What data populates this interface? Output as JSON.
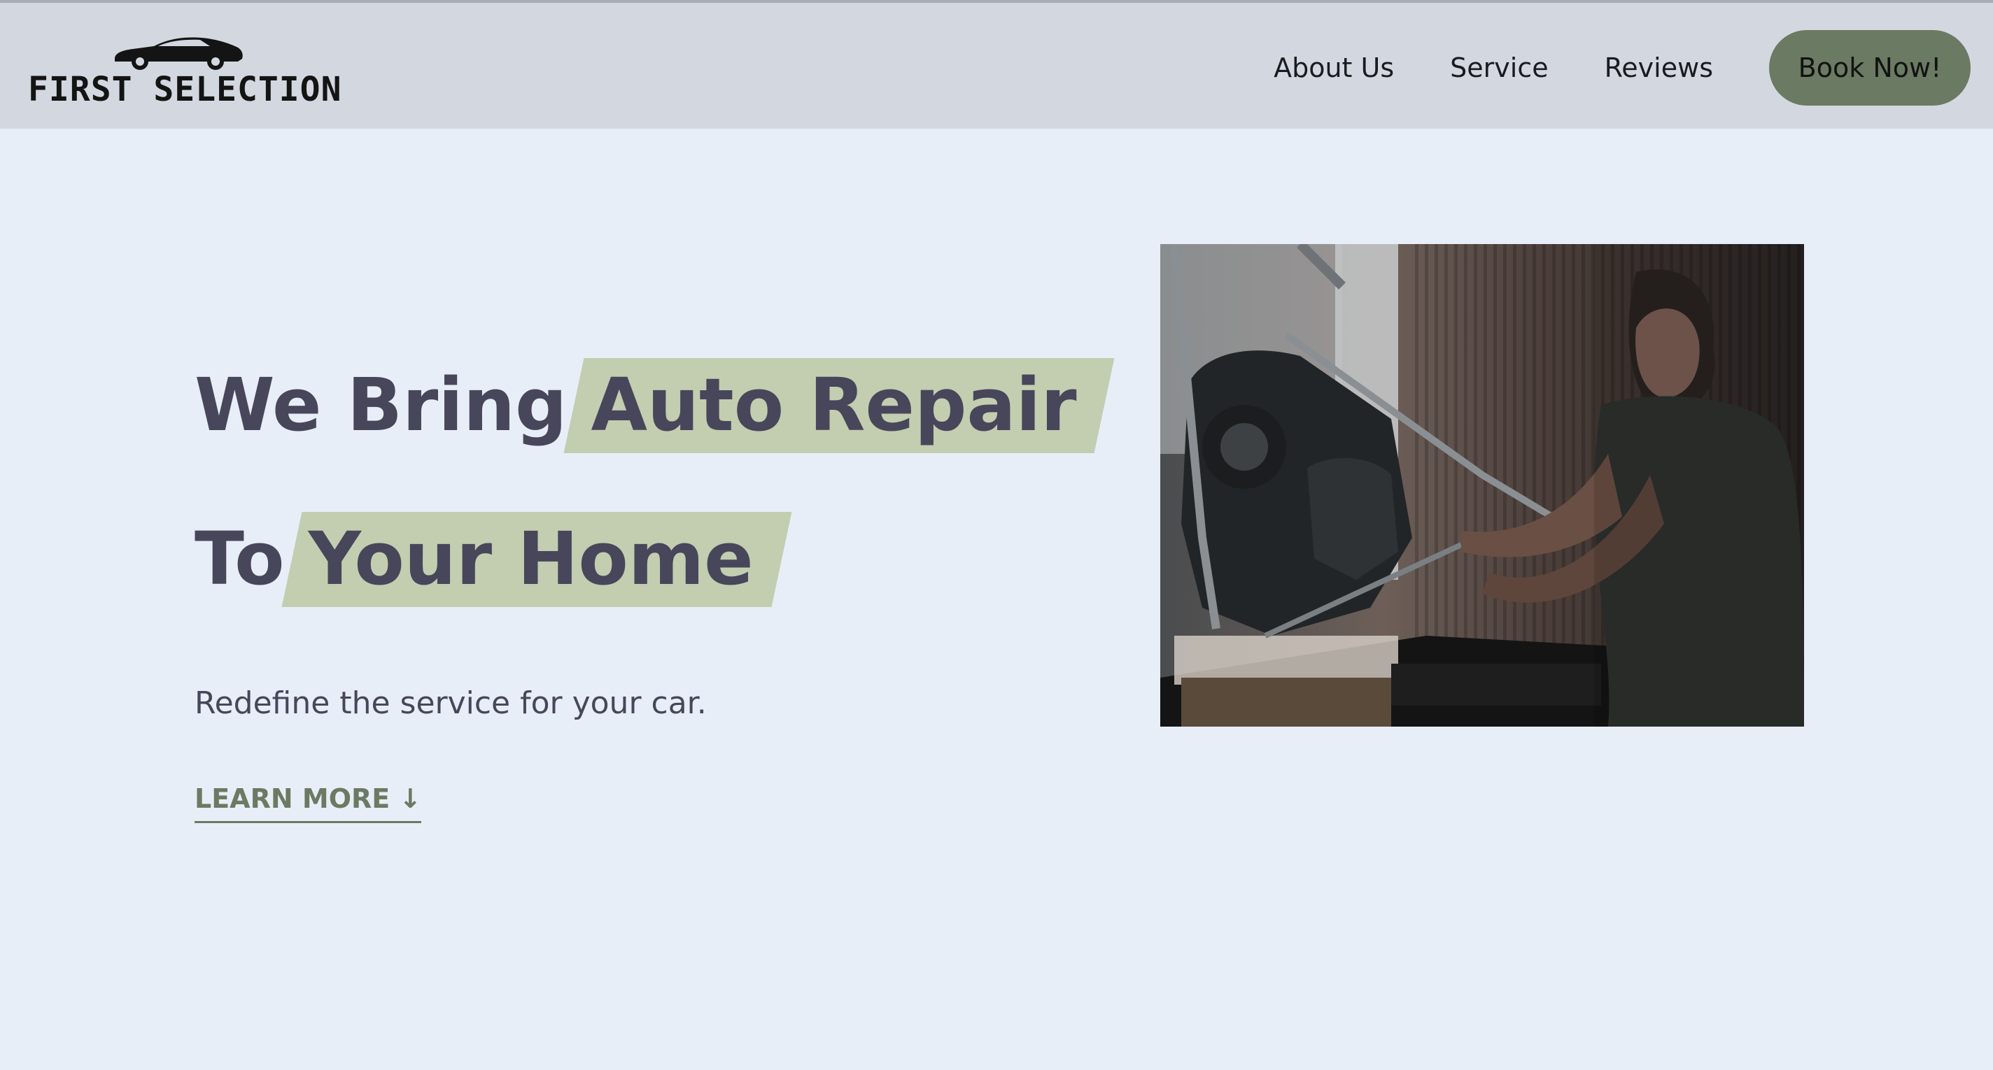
{
  "brand": {
    "name": "FIRST SELECTION",
    "logo_icon": "sports-car-icon"
  },
  "nav": {
    "items": [
      {
        "label": "About Us"
      },
      {
        "label": "Service"
      },
      {
        "label": "Reviews"
      }
    ],
    "cta_label": "Book Now!"
  },
  "hero": {
    "line1_plain": "We Bring",
    "line1_highlight": "Auto Repair",
    "line2_plain": "To",
    "line2_highlight": "Your Home",
    "subtitle": "Redefine the service for your car.",
    "learn_more_label": "LEARN MORE",
    "learn_more_icon": "arrow-down-icon"
  },
  "colors": {
    "page_bg": "#e8eef8",
    "header_bg": "#d3d8e0",
    "accent": "#6b7a62",
    "highlight": "#c3cdb0",
    "heading_text": "#48465a"
  }
}
